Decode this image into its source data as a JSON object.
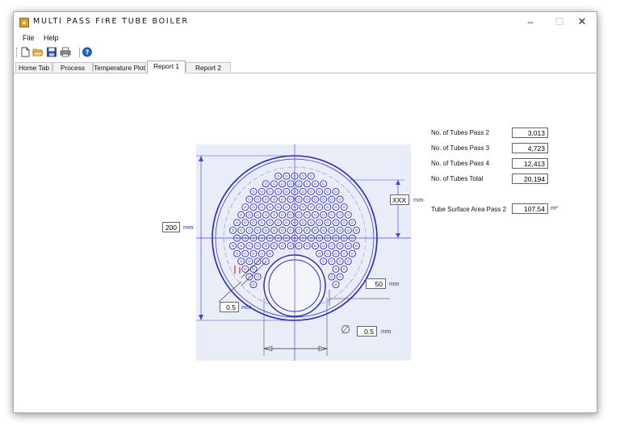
{
  "window": {
    "title": "MULTI PASS FIRE TUBE BOILER",
    "controls": {
      "minimize": "–",
      "maximize": "☐",
      "close": "✕"
    }
  },
  "menu": {
    "file": "File",
    "help": "Help"
  },
  "toolbar": [
    "new-icon",
    "open-icon",
    "save-icon",
    "print-icon",
    "help-icon"
  ],
  "tabs": [
    {
      "label": "Home Tab",
      "active": false
    },
    {
      "label": "Process Calc",
      "active": false
    },
    {
      "label": "Temperature Plot",
      "active": false
    },
    {
      "label": "Report 1",
      "active": true
    },
    {
      "label": "Report 2",
      "active": false
    }
  ],
  "results": [
    {
      "label": "No. of Tubes Pass 2",
      "value": "3,013"
    },
    {
      "label": "No. of Tubes Pass 3",
      "value": "4,723"
    },
    {
      "label": "No. of Tubes Pass 4",
      "value": "12,413"
    },
    {
      "label": "No. of Tubes Total",
      "value": "20,194"
    }
  ],
  "surface_area": {
    "label": "Tube Surface Area Pass 2",
    "value": "107.54",
    "unit": "m²"
  },
  "dimensions": {
    "shell_height": {
      "value": "200",
      "unit": "mm"
    },
    "tube_pitch": {
      "value": "XXX",
      "unit": "mm"
    },
    "ligament": {
      "value": "50",
      "unit": "mm"
    },
    "tube_wall": {
      "value": "0.5",
      "unit": "mm"
    },
    "furnace_dia": {
      "symbol": "∅",
      "value": "0.5",
      "unit": "mm"
    }
  },
  "colors": {
    "drawing": "#2b2bb8",
    "dim_line": "#4a4ac8",
    "accent": "#cc2222"
  }
}
